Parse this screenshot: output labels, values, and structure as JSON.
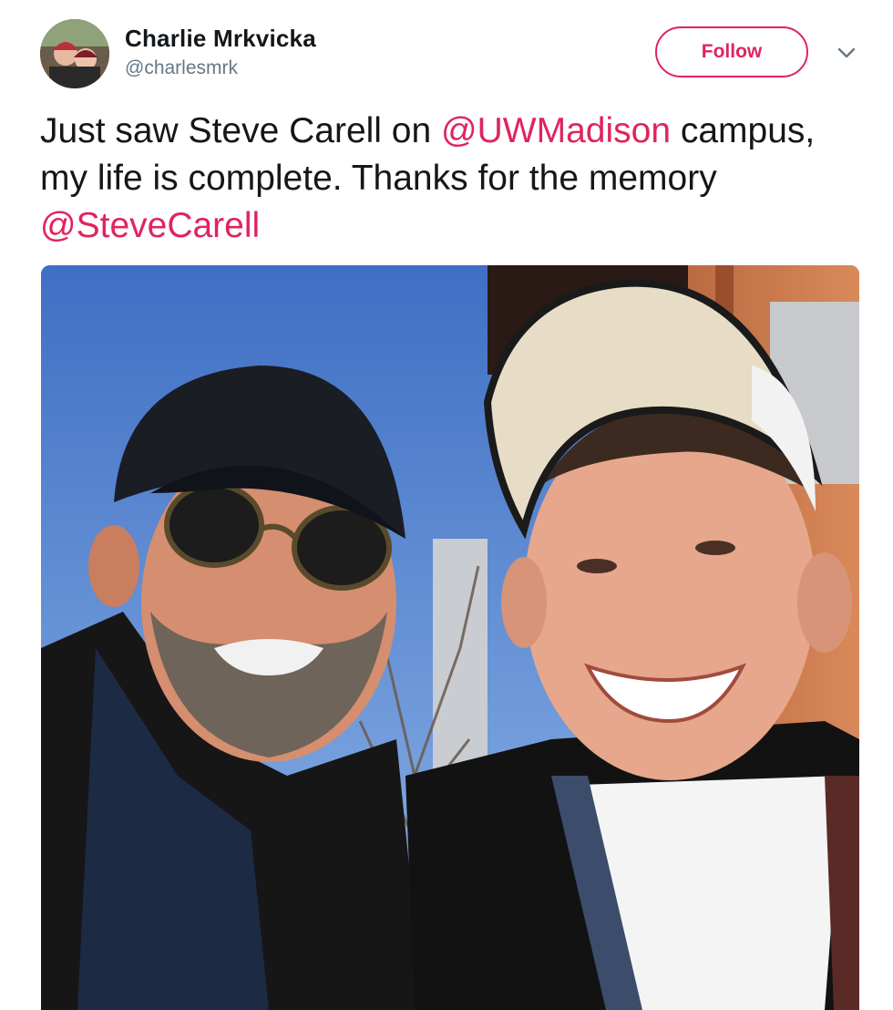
{
  "author": {
    "display_name": "Charlie Mrkvicka",
    "handle": "@charlesmrk",
    "avatar_icon": "profile-photo"
  },
  "actions": {
    "follow_label": "Follow",
    "menu_icon": "chevron-down-icon"
  },
  "tweet": {
    "text_1": "Just saw Steve Carell on ",
    "mention_1": "@UWMadison",
    "text_2": " campus, my life is complete. Thanks for the memory ",
    "mention_2": "@SteveCarell"
  },
  "media": {
    "alt": "Selfie of two men smiling outdoors under a blue sky"
  },
  "colors": {
    "accent": "#e0245e",
    "text": "#14171a",
    "secondary": "#657786"
  }
}
